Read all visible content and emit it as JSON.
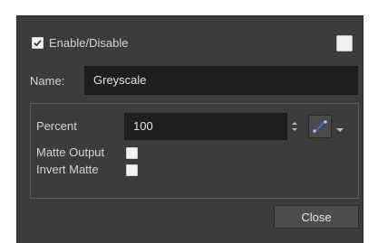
{
  "dialog": {
    "enable_label": "Enable/Disable",
    "enabled": true,
    "name_label": "Name:",
    "name_value": "Greyscale",
    "percent_label": "Percent",
    "percent_value": "100",
    "matte_output_label": "Matte Output",
    "matte_output_checked": false,
    "invert_matte_label": "Invert Matte",
    "invert_matte_checked": false,
    "close_label": "Close"
  },
  "icons": {
    "enable_checkbox": "checkmark-icon",
    "color_swatch": "color-swatch",
    "spinner": "spinner-arrows-icon",
    "function": "function-curve-icon",
    "dropdown": "chevron-down-icon"
  },
  "colors": {
    "background": "#3c3c3c",
    "field": "#1f1f1f",
    "function_accent": "#2f6fd0"
  }
}
